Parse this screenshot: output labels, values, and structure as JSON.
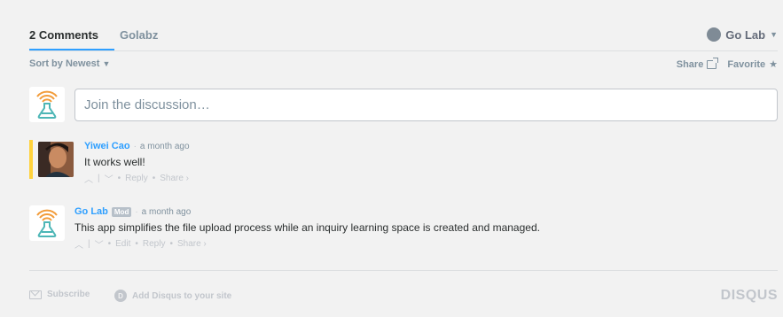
{
  "nav": {
    "comments_tab": "2 Comments",
    "forum_tab": "Golabz",
    "user_name": "Go Lab"
  },
  "sort": {
    "label": "Sort by Newest"
  },
  "actions": {
    "share": "Share",
    "favorite": "Favorite"
  },
  "composer": {
    "placeholder": "Join the discussion…"
  },
  "comments": [
    {
      "author": "Yiwei Cao",
      "badge": "",
      "time": "a month ago",
      "text": "It works well!",
      "actions": [
        "Reply",
        "Share ›"
      ]
    },
    {
      "author": "Go Lab",
      "badge": "Mod",
      "time": "a month ago",
      "text": "This app simplifies the file upload process while an inquiry learning space is created and managed.",
      "actions": [
        "Edit",
        "Reply",
        "Share ›"
      ]
    }
  ],
  "footer": {
    "subscribe": "Subscribe",
    "add_disqus": "Add Disqus to your site",
    "brand": "DISQUS"
  },
  "colors": {
    "accent": "#2e9fff",
    "highlight": "#ffd23c",
    "muted": "#7f919e",
    "lab_orange": "#f29c3a",
    "lab_teal": "#4db6b6"
  }
}
